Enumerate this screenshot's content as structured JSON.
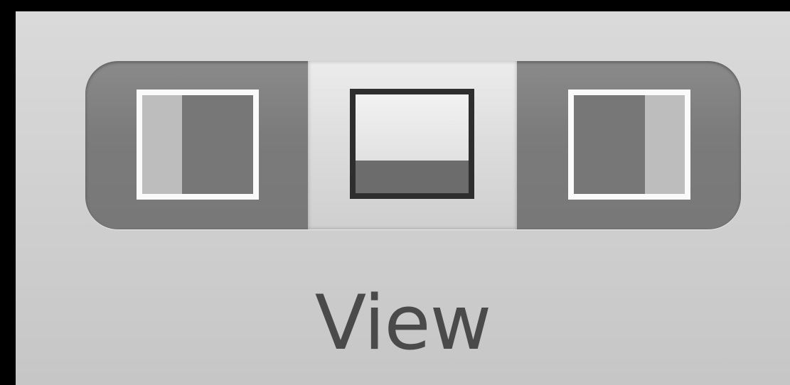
{
  "toolbar": {
    "view_group": {
      "label": "View",
      "segments": [
        {
          "icon": "left-sidebar-icon",
          "selected": false
        },
        {
          "icon": "bottom-pane-icon",
          "selected": true
        },
        {
          "icon": "right-sidebar-icon",
          "selected": false
        }
      ]
    }
  }
}
